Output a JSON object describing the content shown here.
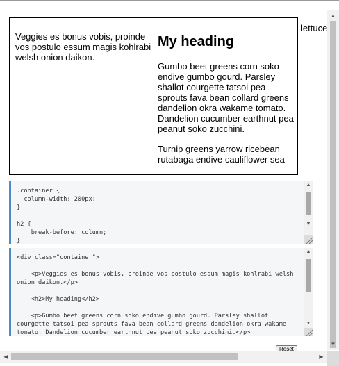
{
  "demo": {
    "paragraph1": "Veggies es bonus vobis, proinde vos postulo essum magis kohlrabi welsh onion daikon.",
    "heading": "My heading",
    "paragraph2": "Gumbo beet greens corn soko endive gumbo gourd. Parsley shallot courgette tatsoi pea sprouts fava bean collard greens dandelion okra wakame tomato. Dandelion cucumber earthnut pea peanut soko zucchini.",
    "paragraph3": "Turnip greens yarrow ricebean rutabaga endive cauliflower sea",
    "overflow_word": "lettuce"
  },
  "css_editor": {
    "code": ".container {\n  column-width: 200px;\n}\n\nh2 {\n    break-before: column;\n}"
  },
  "html_editor": {
    "code": "<div class=\"container\">\n\n    <p>Veggies es bonus vobis, proinde vos postulo essum magis kohlrabi welsh\nonion daikon.</p>\n\n    <h2>My heading</h2>\n\n    <p>Gumbo beet greens corn soko endive gumbo gourd. Parsley shallot\ncourgette tatsoi pea sprouts fava bean collard greens dandelion okra wakame\ntomato. Dandelion cucumber earthnut pea peanut soko zucchini.</p>"
  },
  "controls": {
    "reset_label": "Reset"
  },
  "icons": {
    "up": "arrow-up-icon",
    "down": "arrow-down-icon",
    "left": "arrow-left-icon",
    "right": "arrow-right-icon",
    "resize": "resize-grip-icon"
  },
  "colors": {
    "editor_accent": "#4d8cc4",
    "editor_background": "#f4f6f8"
  }
}
